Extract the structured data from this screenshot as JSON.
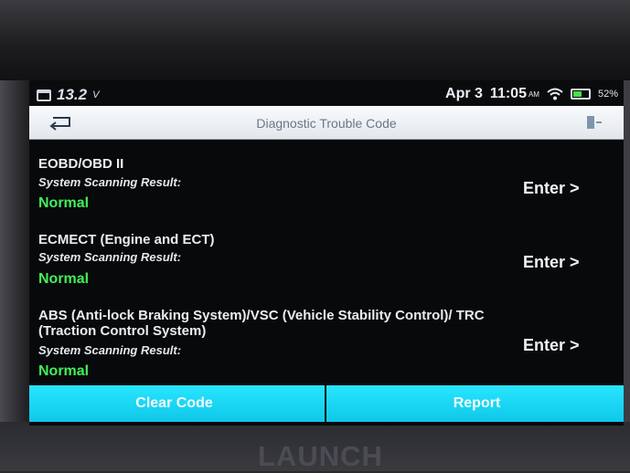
{
  "status_bar": {
    "voltage": "13.2",
    "voltage_unit": "V",
    "date": "Apr 3",
    "time": "11:05",
    "ampm": "AM",
    "battery_percent": "52%"
  },
  "header": {
    "title": "Diagnostic Trouble Code"
  },
  "systems": [
    {
      "name": "EOBD/OBD II",
      "scan_label": "System Scanning Result:",
      "result": "Normal",
      "enter_label": "Enter >"
    },
    {
      "name": "ECMECT (Engine and ECT)",
      "scan_label": "System Scanning Result:",
      "result": "Normal",
      "enter_label": "Enter >"
    },
    {
      "name": "ABS (Anti-lock Braking System)/VSC (Vehicle Stability Control)/ TRC (Traction Control System)",
      "scan_label": "System Scanning Result:",
      "result": "Normal",
      "enter_label": "Enter >"
    }
  ],
  "actions": {
    "clear_code": "Clear Code",
    "report": "Report"
  },
  "brand": "LAUNCH",
  "colors": {
    "result_normal": "#42ee58",
    "action_button": "#19d4f2"
  },
  "icons": {
    "status": [
      "calendar-icon",
      "wifi-icon",
      "battery-icon"
    ],
    "header": [
      "back-arrow-icon",
      "exit-icon"
    ]
  }
}
